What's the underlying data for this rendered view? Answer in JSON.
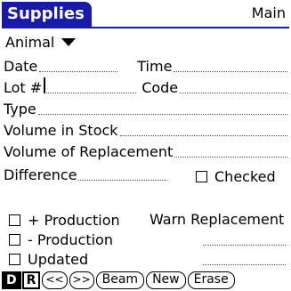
{
  "header": {
    "title": "Supplies",
    "menu": "Main"
  },
  "animal": {
    "label": "Animal"
  },
  "fields": {
    "date": "Date",
    "time": "Time",
    "lot": "Lot #",
    "code": "Code",
    "type": "Type",
    "volume_in_stock": "Volume in Stock",
    "volume_of_replacement": "Volume of Replacement",
    "difference": "Difference",
    "warn_replacement": "Warn Replacement"
  },
  "checkboxes": {
    "checked": "Checked",
    "plus_production": "+ Production",
    "minus_production": "- Production",
    "updated": "Updated"
  },
  "buttons": {
    "d": "D",
    "r": "R",
    "prev": "<<",
    "next": ">>",
    "beam": "Beam",
    "new": "New",
    "erase": "Erase"
  }
}
